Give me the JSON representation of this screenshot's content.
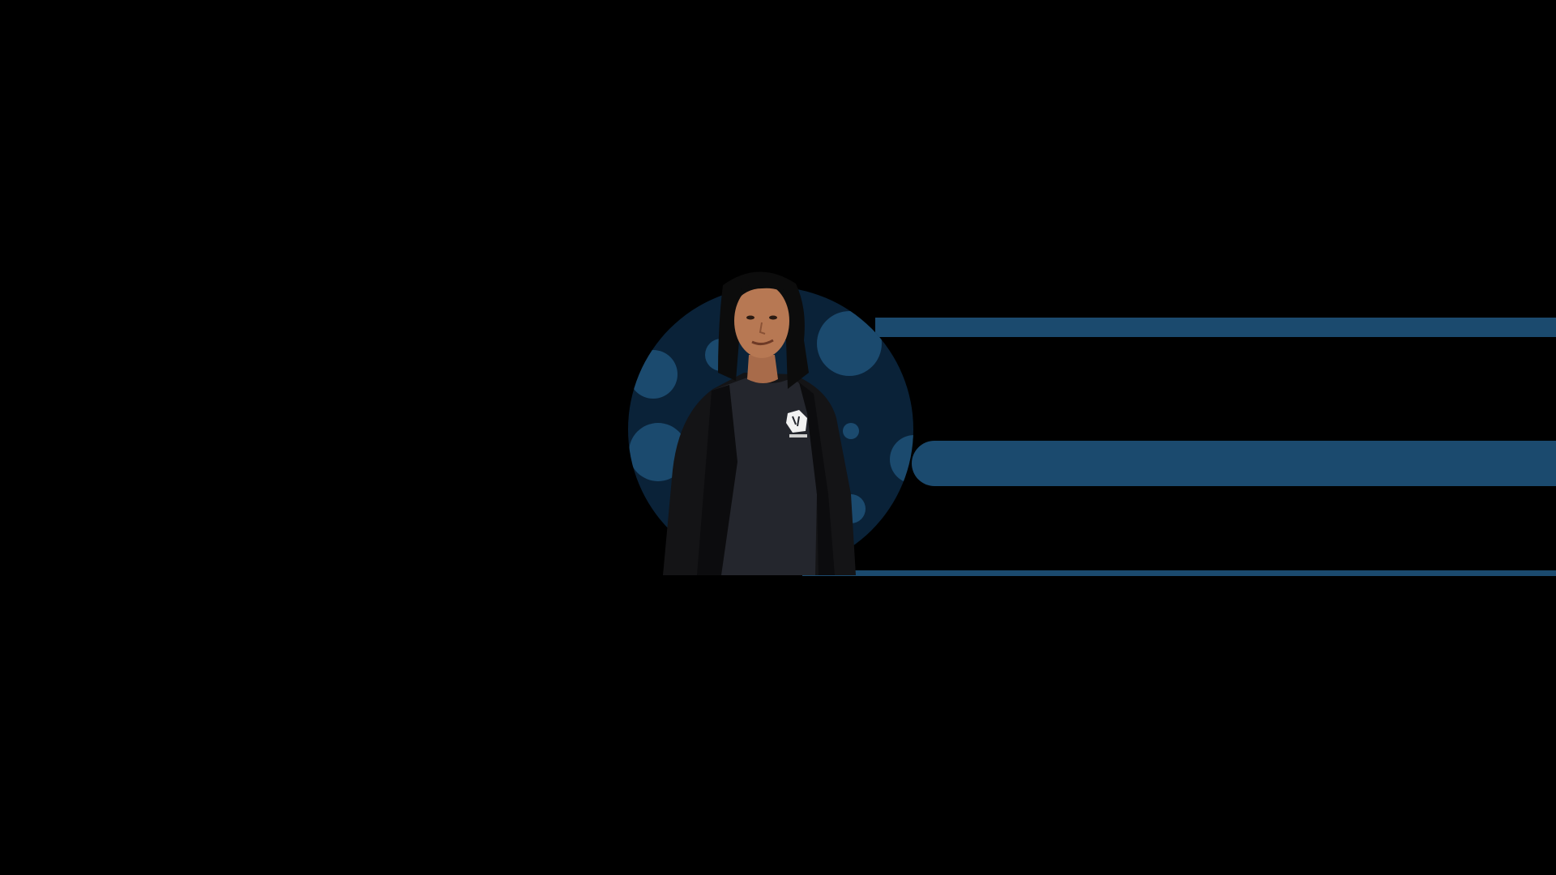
{
  "page": {
    "background": "#000000",
    "accent": "#1b4a6e",
    "circle_background": "#0a2238",
    "dot_color": "#1b4a6e"
  },
  "decor": {
    "bars": [
      {
        "name": "stripe-top",
        "color": "#1b4a6e"
      },
      {
        "name": "stripe-middle",
        "color": "#1b4a6e"
      },
      {
        "name": "stripe-bottom",
        "color": "#1b4a6e"
      }
    ]
  },
  "avatar": {
    "icon": "person-portrait",
    "description_visible_text": ""
  }
}
